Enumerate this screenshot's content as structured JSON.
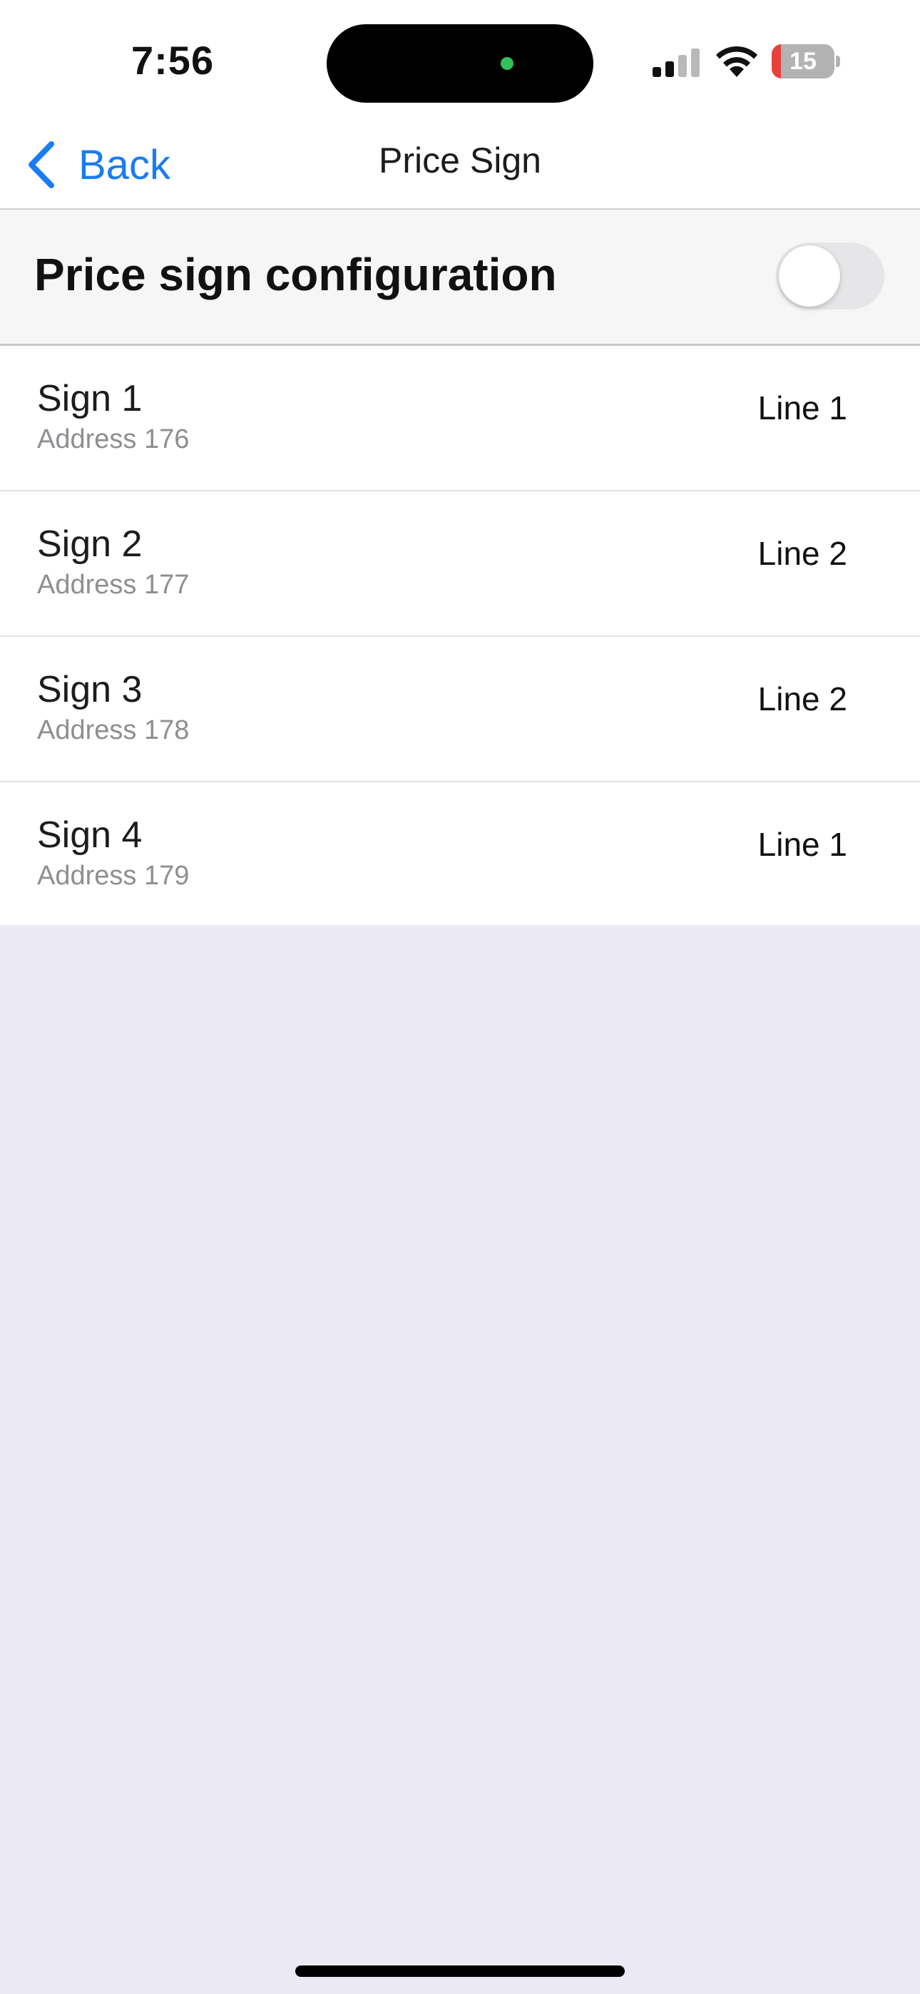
{
  "status_bar": {
    "time": "7:56",
    "battery_level": "15",
    "battery_fraction": 0.15
  },
  "nav": {
    "back_label": "Back",
    "title": "Price Sign"
  },
  "config": {
    "title": "Price sign configuration",
    "enabled": false
  },
  "signs": [
    {
      "name": "Sign 1",
      "address": "Address 176",
      "line": "Line 1"
    },
    {
      "name": "Sign 2",
      "address": "Address 177",
      "line": "Line 2"
    },
    {
      "name": "Sign 3",
      "address": "Address 178",
      "line": "Line 2"
    },
    {
      "name": "Sign 4",
      "address": "Address 179",
      "line": "Line 1"
    }
  ],
  "colors": {
    "accent": "#1a7cf2",
    "background": "#ebe9f4",
    "battery_low": "#e8413b"
  },
  "icons": {
    "back": "chevron-left-icon",
    "signal": "cellular-signal-icon",
    "wifi": "wifi-icon",
    "battery": "battery-icon"
  }
}
